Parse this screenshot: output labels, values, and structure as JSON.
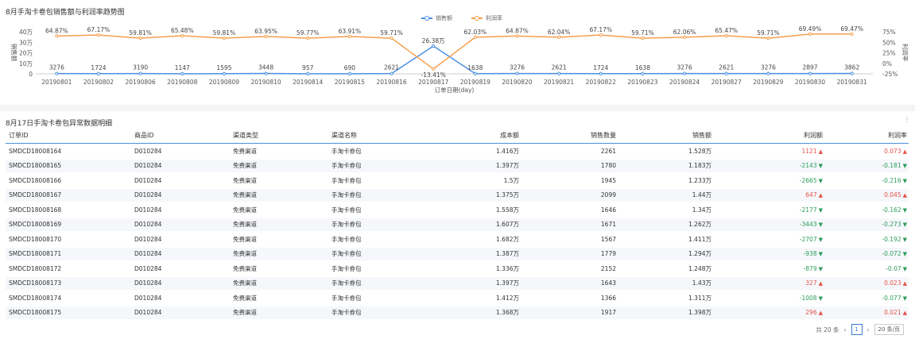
{
  "chart_panel": {
    "title": "8月手淘卡卷包销售额与利润率趋势图"
  },
  "chart_data": {
    "type": "line",
    "title": "8月手淘卡卷包销售额与利润率趋势图",
    "xlabel": "订单日期(day)",
    "ylabel": "销售额",
    "y2label": "利润率",
    "categories": [
      "20190801",
      "20190802",
      "20190806",
      "20190808",
      "20190809",
      "20190810",
      "20190814",
      "20190815",
      "20190816",
      "20190817",
      "20190819",
      "20190820",
      "20190821",
      "20190822",
      "20190823",
      "20190824",
      "20190827",
      "20190829",
      "20190830",
      "20190831"
    ],
    "y_ticks": [
      "40万",
      "30万",
      "20万",
      "10万",
      "0"
    ],
    "y2_ticks": [
      "75%",
      "50%",
      "25%",
      "0%",
      "-25%"
    ],
    "ylim": [
      0,
      40
    ],
    "y2lim": [
      -25,
      75
    ],
    "legend_position": "top-center",
    "series": [
      {
        "name": "销售额",
        "axis": "left",
        "color": "#4a90e2",
        "values": [
          0.3276,
          0.1724,
          0.319,
          0.1147,
          0.1595,
          0.3448,
          0.0957,
          0.069,
          0.2621,
          26.38,
          0.1638,
          0.3276,
          0.2621,
          0.1724,
          0.1638,
          0.3276,
          0.2621,
          0.3276,
          0.2897,
          0.3862
        ],
        "labels": [
          "3276",
          "1724",
          "3190",
          "1147",
          "1595",
          "3448",
          "957",
          "690",
          "2621",
          "26.38万",
          "1638",
          "3276",
          "2621",
          "1724",
          "1638",
          "3276",
          "2621",
          "3276",
          "2897",
          "3862"
        ]
      },
      {
        "name": "利润率",
        "axis": "right",
        "color": "#f5a04d",
        "values": [
          64.87,
          67.17,
          59.81,
          65.48,
          59.81,
          63.95,
          59.77,
          63.91,
          59.71,
          -13.41,
          62.03,
          64.87,
          62.04,
          67.17,
          59.71,
          62.06,
          65.47,
          59.71,
          69.49,
          69.47
        ],
        "labels": [
          "64.87%",
          "67.17%",
          "59.81%",
          "65.48%",
          "59.81%",
          "63.95%",
          "59.77%",
          "63.91%",
          "59.71%",
          "-13.41%",
          "62.03%",
          "64.87%",
          "62.04%",
          "67.17%",
          "59.71%",
          "62.06%",
          "65.47%",
          "59.71%",
          "69.49%",
          "69.47%"
        ]
      }
    ]
  },
  "table_panel": {
    "title": "8月17日手淘卡卷包异常数据明细",
    "more_icon": "more-vertical-icon",
    "headers": [
      "订单ID",
      "商品ID",
      "渠道类型",
      "渠道名称",
      "成本额",
      "销售数量",
      "销售额",
      "利润额",
      "利润率"
    ],
    "rows": [
      [
        "SMDCD18008164",
        "D010284",
        "免费渠道",
        "手淘卡券包",
        "1.416万",
        "2261",
        "1.528万",
        "1121",
        "up",
        "0.073",
        "up"
      ],
      [
        "SMDCD18008165",
        "D010284",
        "免费渠道",
        "手淘卡券包",
        "1.397万",
        "1780",
        "1.183万",
        "-2143",
        "down",
        "-0.181",
        "down"
      ],
      [
        "SMDCD18008166",
        "D010284",
        "免费渠道",
        "手淘卡券包",
        "1.5万",
        "1945",
        "1.233万",
        "-2665",
        "down",
        "-0.216",
        "down"
      ],
      [
        "SMDCD18008167",
        "D010284",
        "免费渠道",
        "手淘卡券包",
        "1.375万",
        "2099",
        "1.44万",
        "647",
        "up",
        "0.045",
        "up"
      ],
      [
        "SMDCD18008168",
        "D010284",
        "免费渠道",
        "手淘卡券包",
        "1.558万",
        "1646",
        "1.34万",
        "-2177",
        "down",
        "-0.162",
        "down"
      ],
      [
        "SMDCD18008169",
        "D010284",
        "免费渠道",
        "手淘卡券包",
        "1.607万",
        "1671",
        "1.262万",
        "-3443",
        "down",
        "-0.273",
        "down"
      ],
      [
        "SMDCD18008170",
        "D010284",
        "免费渠道",
        "手淘卡券包",
        "1.682万",
        "1567",
        "1.411万",
        "-2707",
        "down",
        "-0.192",
        "down"
      ],
      [
        "SMDCD18008171",
        "D010284",
        "免费渠道",
        "手淘卡券包",
        "1.387万",
        "1779",
        "1.294万",
        "-938",
        "down",
        "-0.072",
        "down"
      ],
      [
        "SMDCD18008172",
        "D010284",
        "免费渠道",
        "手淘卡券包",
        "1.336万",
        "2152",
        "1.248万",
        "-879",
        "down",
        "-0.07",
        "down"
      ],
      [
        "SMDCD18008173",
        "D010284",
        "免费渠道",
        "手淘卡券包",
        "1.397万",
        "1643",
        "1.43万",
        "327",
        "up",
        "0.023",
        "up"
      ],
      [
        "SMDCD18008174",
        "D010284",
        "免费渠道",
        "手淘卡券包",
        "1.412万",
        "1366",
        "1.311万",
        "-1008",
        "down",
        "-0.077",
        "down"
      ],
      [
        "SMDCD18008175",
        "D010284",
        "免费渠道",
        "手淘卡券包",
        "1.368万",
        "1917",
        "1.398万",
        "296",
        "up",
        "0.021",
        "up"
      ]
    ],
    "pager": {
      "total": "共 20 条",
      "prev": "‹",
      "page": "1",
      "next": "›",
      "page_size": "20 条/页"
    }
  }
}
